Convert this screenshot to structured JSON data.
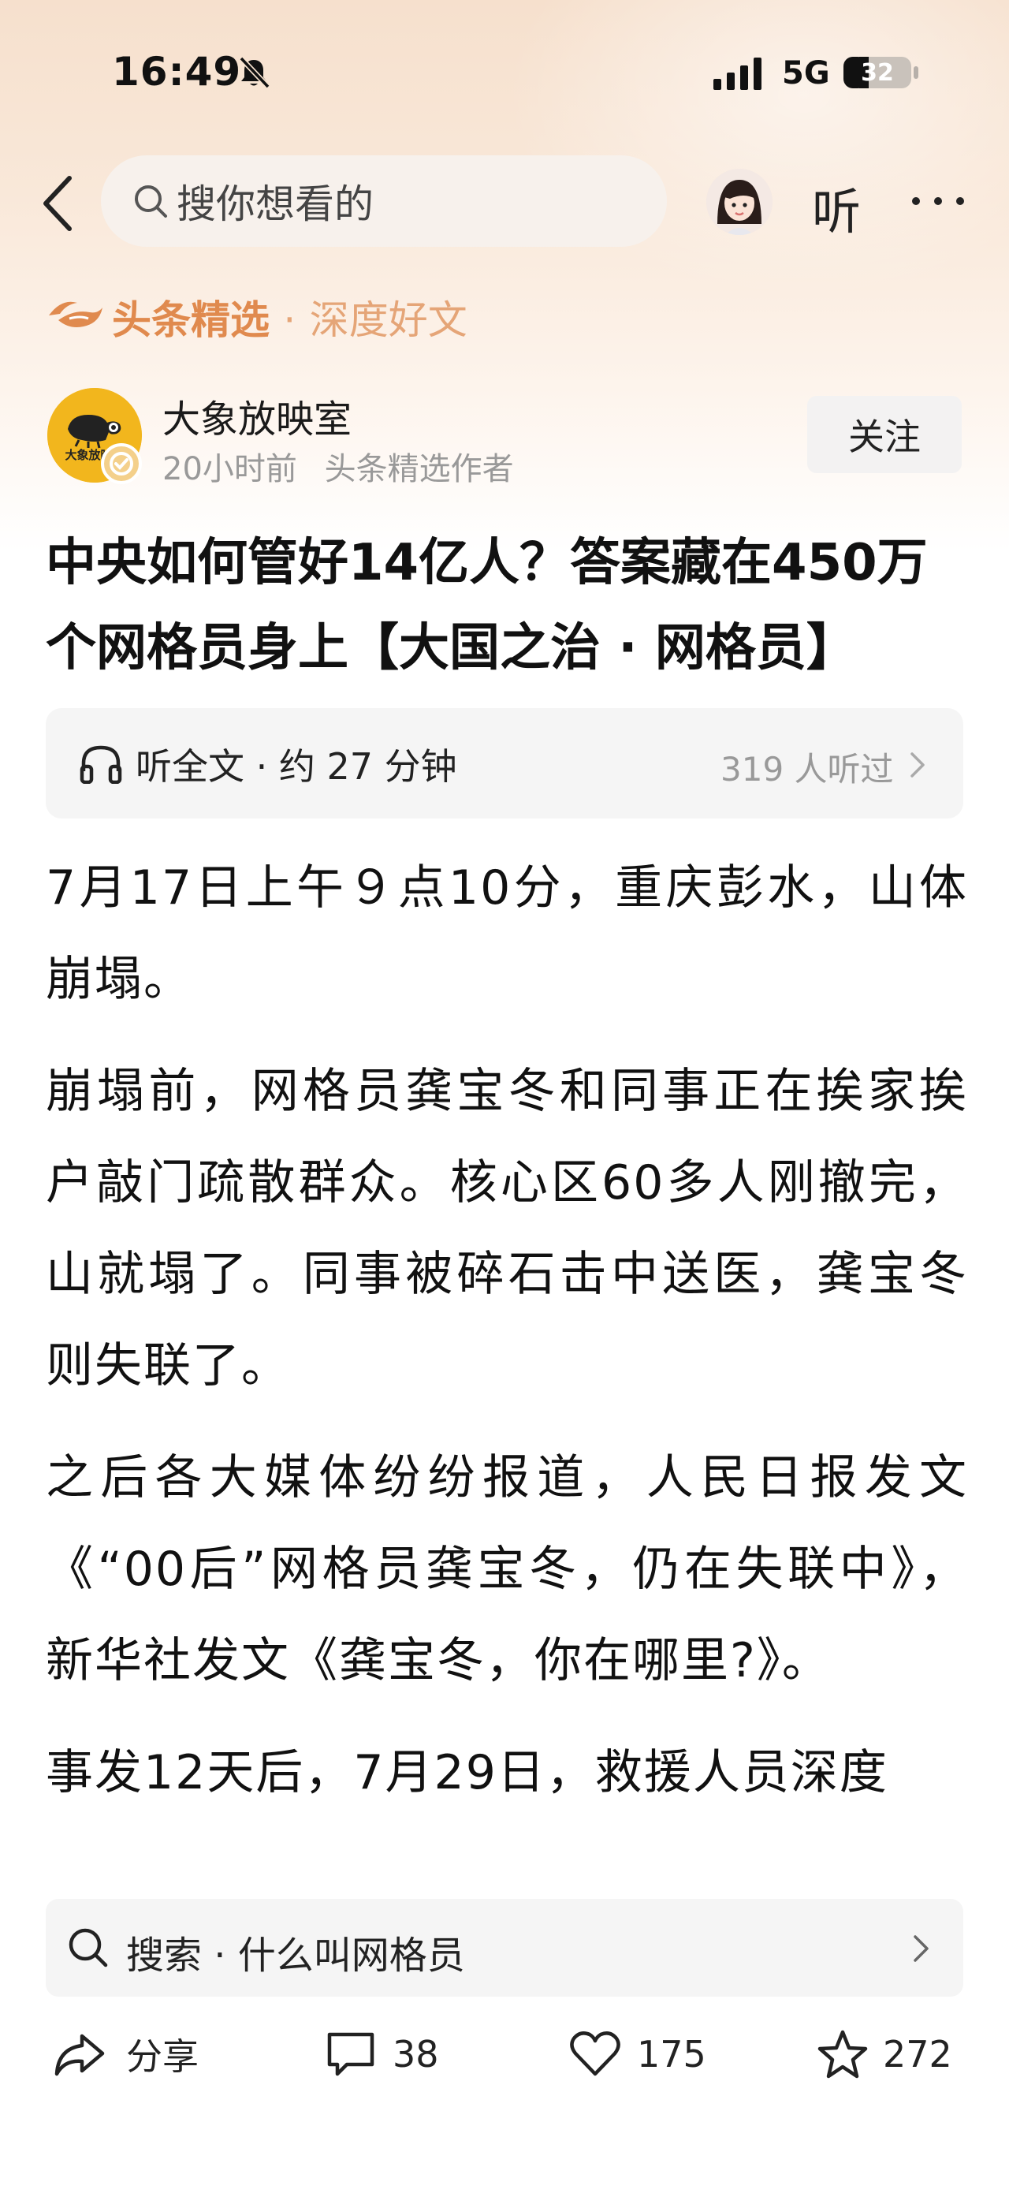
{
  "status_bar": {
    "time": "16:49",
    "network": "5G",
    "battery": "32"
  },
  "nav": {
    "search_placeholder": "搜你想看的",
    "listen_label": "听"
  },
  "featured": {
    "brand": "头条精选",
    "separator": "·",
    "subtitle": "深度好文"
  },
  "author": {
    "name": "大象放映室",
    "avatar_text": "大象放映室",
    "time_ago": "20小时前",
    "role": "头条精选作者",
    "follow_label": "关注"
  },
  "article": {
    "title": "中央如何管好14亿人？答案藏在450万个网格员身上【大国之治 · 网格员】",
    "listen_full": "听全文 · 约 27 分钟",
    "listen_count": "319 人听过",
    "paragraphs": [
      "7月17日上午９点10分，重庆彭水，山体崩塌。",
      "崩塌前，网格员龚宝冬和同事正在挨家挨户敲门疏散群众。核心区60多人刚撤完，山就塌了。同事被碎石击中送医，龚宝冬则失联了。",
      "之后各大媒体纷纷报道，人民日报发文《“00后”网格员龚宝冬，仍在失联中》，新华社发文《龚宝冬，你在哪里?》。",
      "事发12天后，7月29日，救援人员深度"
    ]
  },
  "suggestion": {
    "label": "搜索 · 什么叫网格员"
  },
  "actions": {
    "share_label": "分享",
    "comment_count": "38",
    "like_count": "175",
    "favorite_count": "272"
  },
  "colors": {
    "brand_orange": "#e08a4e",
    "avatar_yellow": "#f2b61d"
  }
}
